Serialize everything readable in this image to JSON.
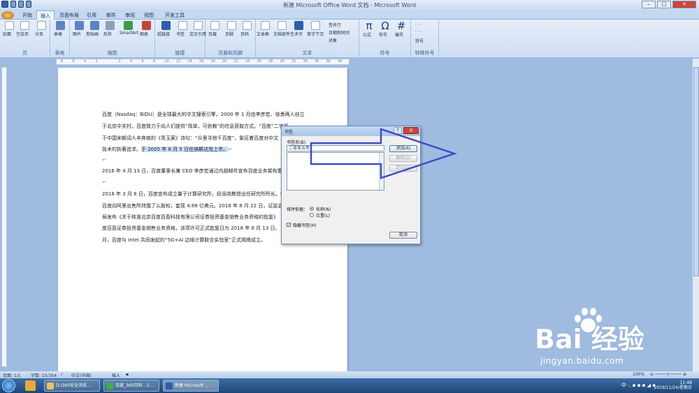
{
  "window": {
    "title": "新建 Microsoft Office Word 文档 - Microsoft Word"
  },
  "tabs": [
    "开始",
    "插入",
    "页面布局",
    "引用",
    "邮件",
    "审阅",
    "视图",
    "开发工具"
  ],
  "active_tab": "插入",
  "ribbon": {
    "pages": {
      "label": "页",
      "buttons": [
        "封面",
        "空白页",
        "分页"
      ]
    },
    "tables": {
      "label": "表格",
      "buttons": [
        "表格"
      ]
    },
    "illustrations": {
      "label": "插图",
      "buttons": [
        "图片",
        "剪贴画",
        "形状",
        "SmartArt",
        "图表"
      ]
    },
    "links": {
      "label": "链接",
      "buttons": [
        "超链接",
        "书签",
        "交叉引用"
      ]
    },
    "header_footer": {
      "label": "页眉和页脚",
      "buttons": [
        "页眉",
        "页脚",
        "页码"
      ]
    },
    "text": {
      "label": "文本",
      "buttons": [
        "文本框",
        "文档部件",
        "艺术字",
        "首字下沉"
      ],
      "small": [
        "签名行",
        "日期和时间",
        "对象"
      ]
    },
    "symbols": {
      "label": "符号",
      "buttons": [
        "公式",
        "符号",
        "编号"
      ],
      "glyphs": [
        "π",
        "Ω",
        "#"
      ]
    },
    "special": {
      "label": "特殊符号",
      "small": [
        "符号"
      ]
    }
  },
  "ruler": {
    "marks": [
      "8",
      "6",
      "4",
      "2",
      "",
      "2",
      "4",
      "6",
      "8",
      "10",
      "12",
      "14",
      "16",
      "18",
      "20",
      "22",
      "24",
      "26",
      "28",
      "30",
      "32",
      "34",
      "36",
      "38",
      "40"
    ]
  },
  "document": {
    "lines": [
      "百度（Nasdaq：BIDU）是全球最大的中文搜索引擎，2000 年 1 月由李彦宏、徐勇两人创立",
      "于北京中关村，百度致力于向人们提供“简单，可依赖”的信息获取方式。“百度”二字源",
      "于中国宋朝词人辛弃疾的《青玉案》诗句：“众里寻他千百度”，象征着百度对中文",
      "技术的执著追求。",
      "↵",
      "2016 年 4 月 13 日，百度董事长兼 CEO 李彦宏通过内部邮件宣布百度业务架构重",
      "↵",
      "2018 年 3 月 8 日，百度宣布成立量子计算研究所，段润尧教授出任研究所所长。5",
      "百度向阿里出售所持饿了么股权，套现 4.88 亿美元。2018 年 8 月 22 日，证监会",
      "局发布《关于核准北京百度百盈科技有限公司证券投资基金销售业务资格的批复》",
      "度百盈证券投资基金销售业务资格，该项许可正式批复日为 2018 年 8 月 13 日。",
      "月，百度与 Intel 共同发起的“5G+AI 边缘计算联合实验室”正式揭牌成立。"
    ],
    "selected": "于 2005 年 8 月 5 日在纳斯达克上市。"
  },
  "dialog": {
    "title": "书签",
    "name_label": "书签名(B):",
    "name_value": "二零零五年",
    "add": "添加(A)",
    "delete": "删除(D)",
    "goto": "定位(G)",
    "sort_label": "排序依据：",
    "sort_name": "名称(N)",
    "sort_location": "位置(L)",
    "hidden": "隐藏书签(H)",
    "cancel": "取消",
    "help": "?",
    "close": "X"
  },
  "status": {
    "page": "页面: 1/1",
    "words": "字数: 15/354",
    "lang": "中文(中国)",
    "mode": "插入",
    "zoom": "100%"
  },
  "taskbar": {
    "items": [
      "D:\\360安全浏览...",
      "百度_360百科 - 3...",
      "新建 Microsoft ..."
    ],
    "time": "11:48",
    "date": "2019/11/24/星期日",
    "tray": "中 ·,"
  },
  "watermark": {
    "logo": "Bai 经验",
    "url": "jingyan.baidu.com"
  },
  "colors": {
    "accent": "#3f4dc3",
    "selection": "#c7dcf7"
  }
}
